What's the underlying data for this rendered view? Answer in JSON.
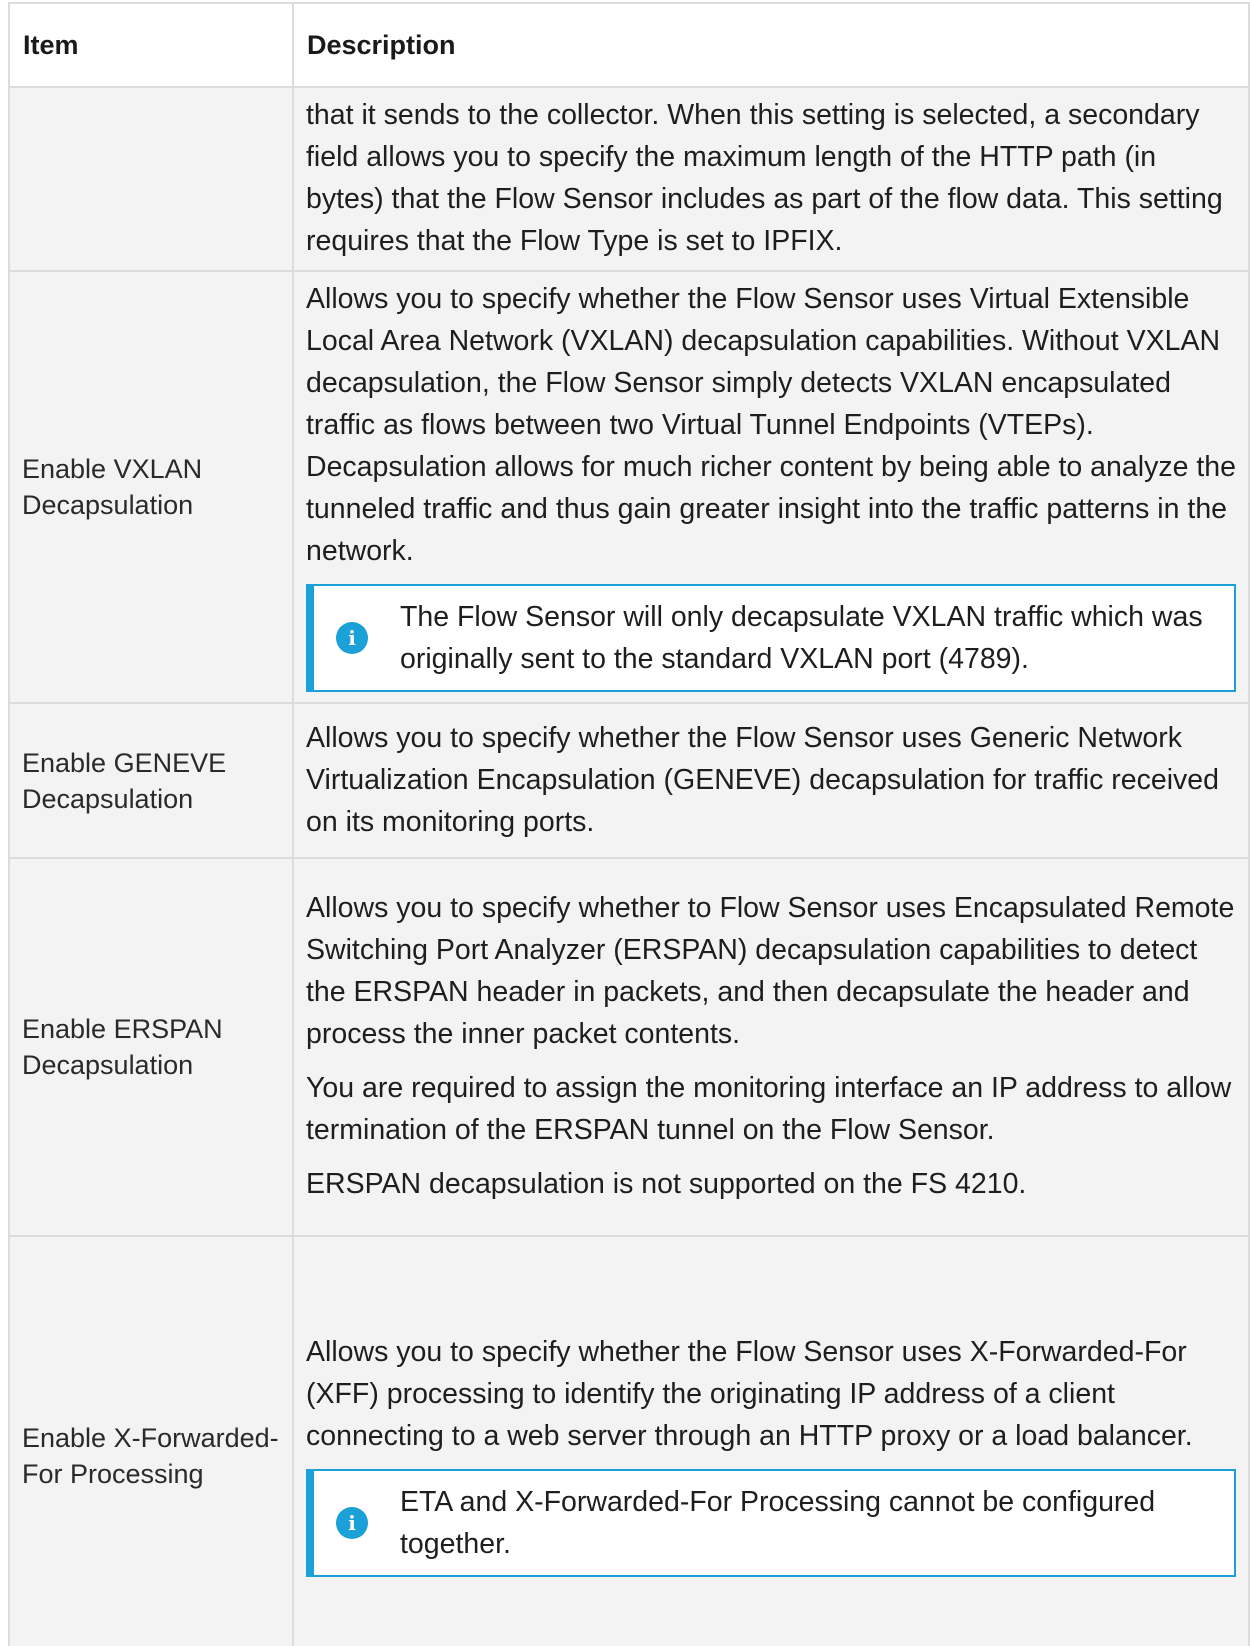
{
  "table": {
    "headers": {
      "item": "Item",
      "description": "Description"
    },
    "rows": [
      {
        "item": "",
        "paragraphs": [
          "that it sends to the collector. When this setting is selected, a secondary field allows you to specify the maximum length of the HTTP path (in bytes) that the Flow Sensor includes as part of the flow data. This setting requires that the Flow Type is set to IPFIX."
        ]
      },
      {
        "item": "Enable VXLAN Decapsulation",
        "paragraphs": [
          "Allows you to specify whether the Flow Sensor uses Virtual Extensible Local Area Network (VXLAN) decapsulation capabilities. Without VXLAN decapsulation, the Flow Sensor simply detects VXLAN encapsulated traffic as flows between two Virtual Tunnel Endpoints (VTEPs). Decapsulation allows for much richer content by being able to analyze the tunneled traffic and thus gain greater insight into the traffic patterns in the network."
        ],
        "note": "The Flow Sensor will only decapsulate VXLAN traffic which was originally sent to the standard VXLAN port (4789)."
      },
      {
        "item": "Enable GENEVE Decapsulation",
        "paragraphs": [
          "Allows you to specify whether the Flow Sensor uses Generic Network Virtualization Encapsulation (GENEVE) decapsulation for traffic received on its monitoring ports."
        ]
      },
      {
        "item": "Enable ERSPAN Decapsulation",
        "paragraphs": [
          "Allows you to specify whether to Flow Sensor uses Encapsulated Remote Switching Port Analyzer (ERSPAN) decapsulation capabilities to detect the ERSPAN header in packets, and then decapsulate the header and process the inner packet contents.",
          "You are required to assign the monitoring interface an IP address to allow termination of the ERSPAN tunnel on the Flow Sensor.",
          "ERSPAN decapsulation is not supported on the FS 4210."
        ]
      },
      {
        "item": "Enable X-Forwarded-For Processing",
        "paragraphs": [
          "Allows you to specify whether the Flow Sensor uses X-Forwarded-For (XFF) processing to identify the originating IP address of a client connecting to a web server through an HTTP proxy or a load balancer."
        ],
        "note": "ETA and X-Forwarded-For Processing cannot be configured together."
      }
    ],
    "note_icon": "info-icon",
    "colors": {
      "accent": "#1ba0d7",
      "cell_background": "#f3f3f3",
      "border": "#dcdcdc"
    }
  }
}
